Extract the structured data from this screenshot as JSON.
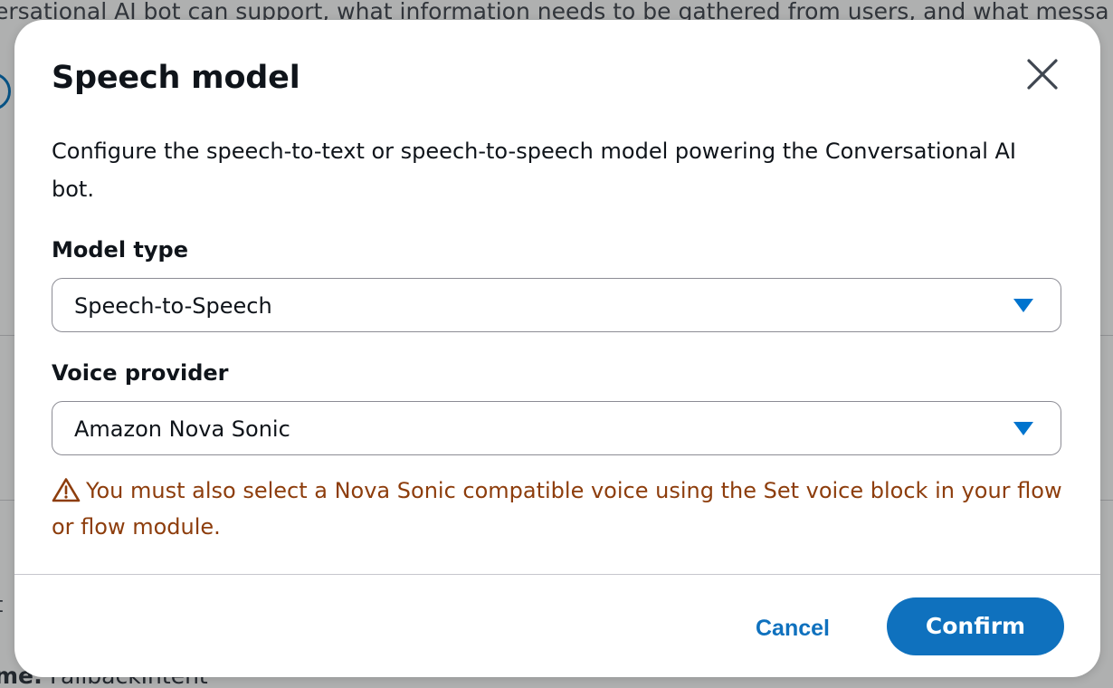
{
  "background": {
    "top_text": "ersational AI bot can support, what information needs to be gathered from users, and what messa",
    "side_letter": "t",
    "bottom_label": "me:",
    "bottom_value": "FallbackIntent"
  },
  "modal": {
    "title": "Speech model",
    "close_icon": "close-icon",
    "description": "Configure the speech-to-text or speech-to-speech model powering the Conversational AI bot.",
    "fields": [
      {
        "label": "Model type",
        "value": "Speech-to-Speech"
      },
      {
        "label": "Voice provider",
        "value": "Amazon Nova Sonic"
      }
    ],
    "warning": {
      "icon": "warning-icon",
      "text": "You must also select a Nova Sonic compatible voice using the Set voice block in your flow or flow module."
    },
    "footer": {
      "cancel_label": "Cancel",
      "confirm_label": "Confirm"
    }
  },
  "colors": {
    "accent": "#006ce0",
    "warning": "#8d3d0c",
    "text": "#0f141a"
  }
}
